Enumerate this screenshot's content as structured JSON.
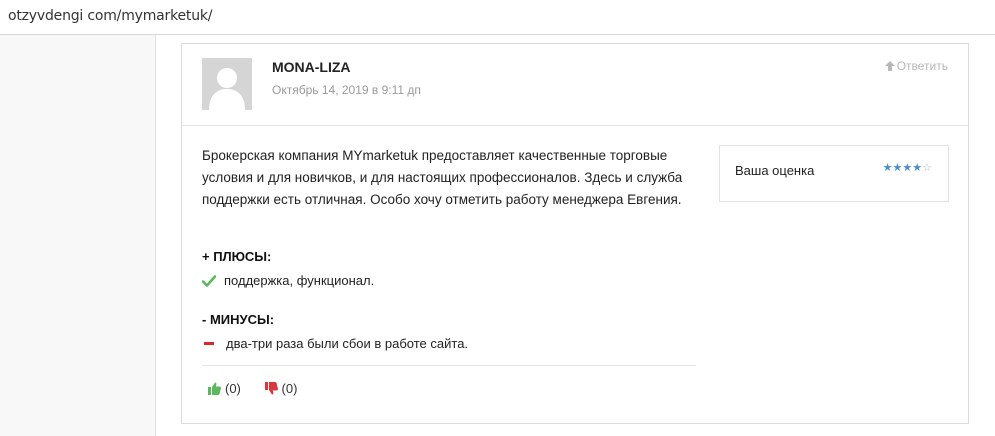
{
  "browser": {
    "url": "otzyvdengi com/mymarketuk/"
  },
  "comment": {
    "author": "MONA-LIZA",
    "date": "Октябрь 14, 2019 в 9:11 дп",
    "reply_label": "Ответить",
    "text": "Брокерская компания MYmarketuk предоставляет качественные торговые условия и для новичков, и для настоящих профессионалов. Здесь и служба поддержки есть отличная. Особо хочу отметить работу менеджера Евгения.",
    "pros_title": "+ ПЛЮСЫ:",
    "pros_text": "поддержка, функционал.",
    "cons_title": "- МИНУСЫ:",
    "cons_text": "два-три раза были сбои в работе сайта.",
    "likes": "(0)",
    "dislikes": "(0)"
  },
  "rating": {
    "label": "Ваша оценка",
    "value": 4,
    "max": 5,
    "color": "#4a8cd0"
  },
  "colors": {
    "check": "#5cb85c",
    "minus": "#e0242b",
    "thumb_up": "#5cb85c",
    "thumb_down": "#d9363e"
  }
}
